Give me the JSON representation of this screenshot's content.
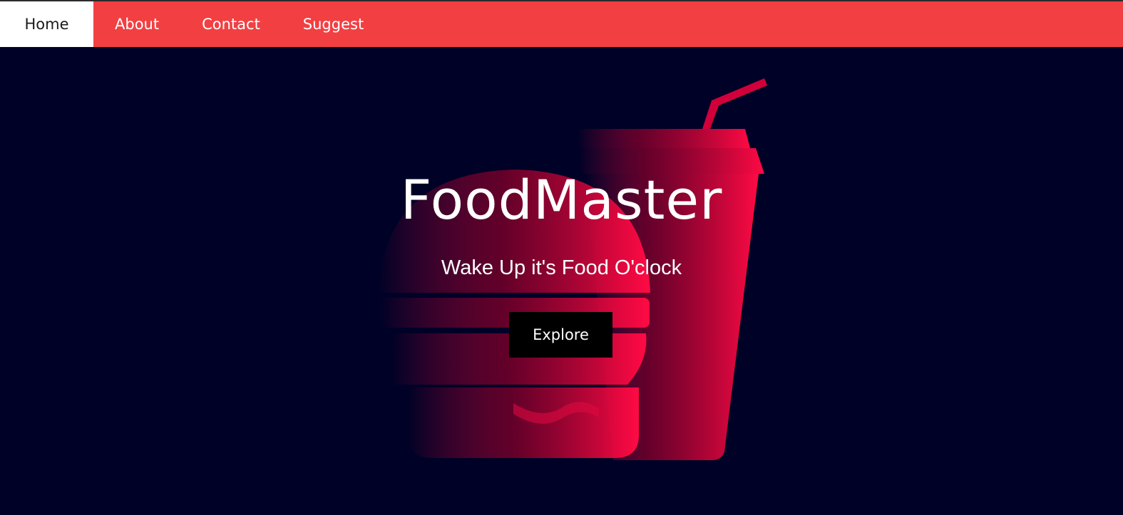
{
  "nav": {
    "items": [
      {
        "label": "Home",
        "active": true
      },
      {
        "label": "About",
        "active": false
      },
      {
        "label": "Contact",
        "active": false
      },
      {
        "label": "Suggest",
        "active": false
      }
    ]
  },
  "hero": {
    "title": "FoodMaster",
    "subtitle": "Wake Up it's Food O'clock",
    "cta_label": "Explore"
  },
  "colors": {
    "nav_background": "#f23f42",
    "hero_background": "#000126",
    "art_accent": "#ff0a44",
    "button_background": "#000000"
  },
  "icons": {
    "burger": "burger-icon",
    "drink": "drink-cup-icon"
  }
}
